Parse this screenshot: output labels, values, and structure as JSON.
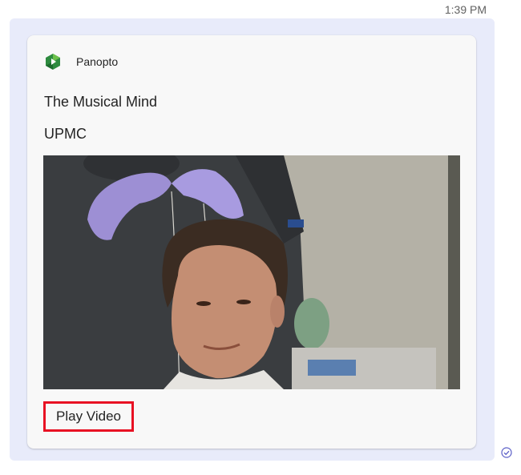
{
  "message": {
    "timestamp": "1:39 PM"
  },
  "card": {
    "app_name": "Panopto",
    "app_icon": "panopto-logo-icon",
    "title": "The Musical Mind",
    "subtitle": "UPMC",
    "thumbnail_icon": "video-thumbnail",
    "action_label": "Play Video"
  },
  "status": {
    "icon": "sent-check-icon"
  },
  "colors": {
    "bubble_bg": "#e8ebfa",
    "card_bg": "#f8f8f8",
    "highlight_border": "#e81123",
    "panopto_green": "#2e8b3f",
    "sent_icon": "#5b5fc7"
  }
}
